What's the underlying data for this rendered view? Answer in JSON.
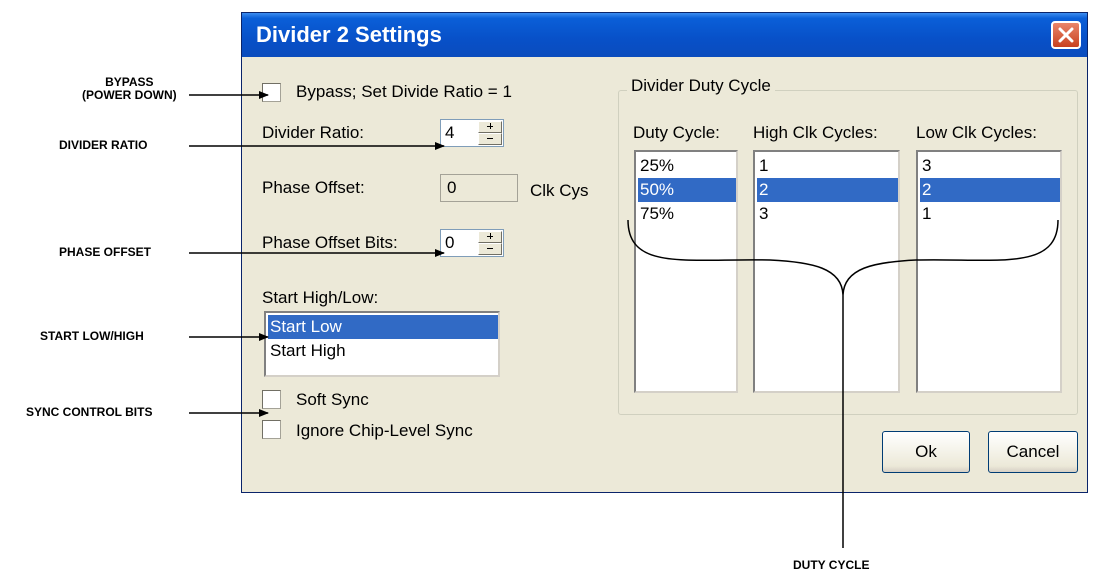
{
  "annotations": {
    "bypass_line1": "BYPASS",
    "bypass_line2": "(POWER DOWN)",
    "divider_ratio": "DIVIDER RATIO",
    "phase_offset": "PHASE OFFSET",
    "start_low_high": "START LOW/HIGH",
    "sync_control_bits": "SYNC CONTROL BITS",
    "duty_cycle": "DUTY CYCLE"
  },
  "dialog": {
    "title": "Divider 2 Settings",
    "bypass_label": "Bypass; Set Divide Ratio = 1",
    "bypass_checked": false,
    "divider_ratio_label": "Divider Ratio:",
    "divider_ratio_value": "4",
    "phase_offset_label": "Phase Offset:",
    "phase_offset_value": "0",
    "phase_offset_unit": "Clk Cys",
    "phase_offset_bits_label": "Phase Offset Bits:",
    "phase_offset_bits_value": "0",
    "start_label": "Start High/Low:",
    "start_options": [
      "Start Low",
      "Start High"
    ],
    "start_selected": "Start Low",
    "soft_sync_label": "Soft Sync",
    "soft_sync_checked": false,
    "ignore_sync_label": "Ignore Chip-Level Sync",
    "ignore_sync_checked": false,
    "duty_group_title": "Divider Duty Cycle",
    "duty_cycle_header": "Duty Cycle:",
    "duty_cycle_items": [
      "25%",
      "50%",
      "75%"
    ],
    "high_clk_header": "High Clk Cycles:",
    "high_clk_items": [
      "1",
      "2",
      "3"
    ],
    "low_clk_header": "Low Clk Cycles:",
    "low_clk_items": [
      "3",
      "2",
      "1"
    ],
    "selected_row": 1,
    "ok_label": "Ok",
    "cancel_label": "Cancel"
  },
  "colors": {
    "title_bar": "#0a50c8",
    "selection": "#316ac5",
    "dialog_bg": "#ece9d8",
    "close_button": "#d4502c"
  }
}
